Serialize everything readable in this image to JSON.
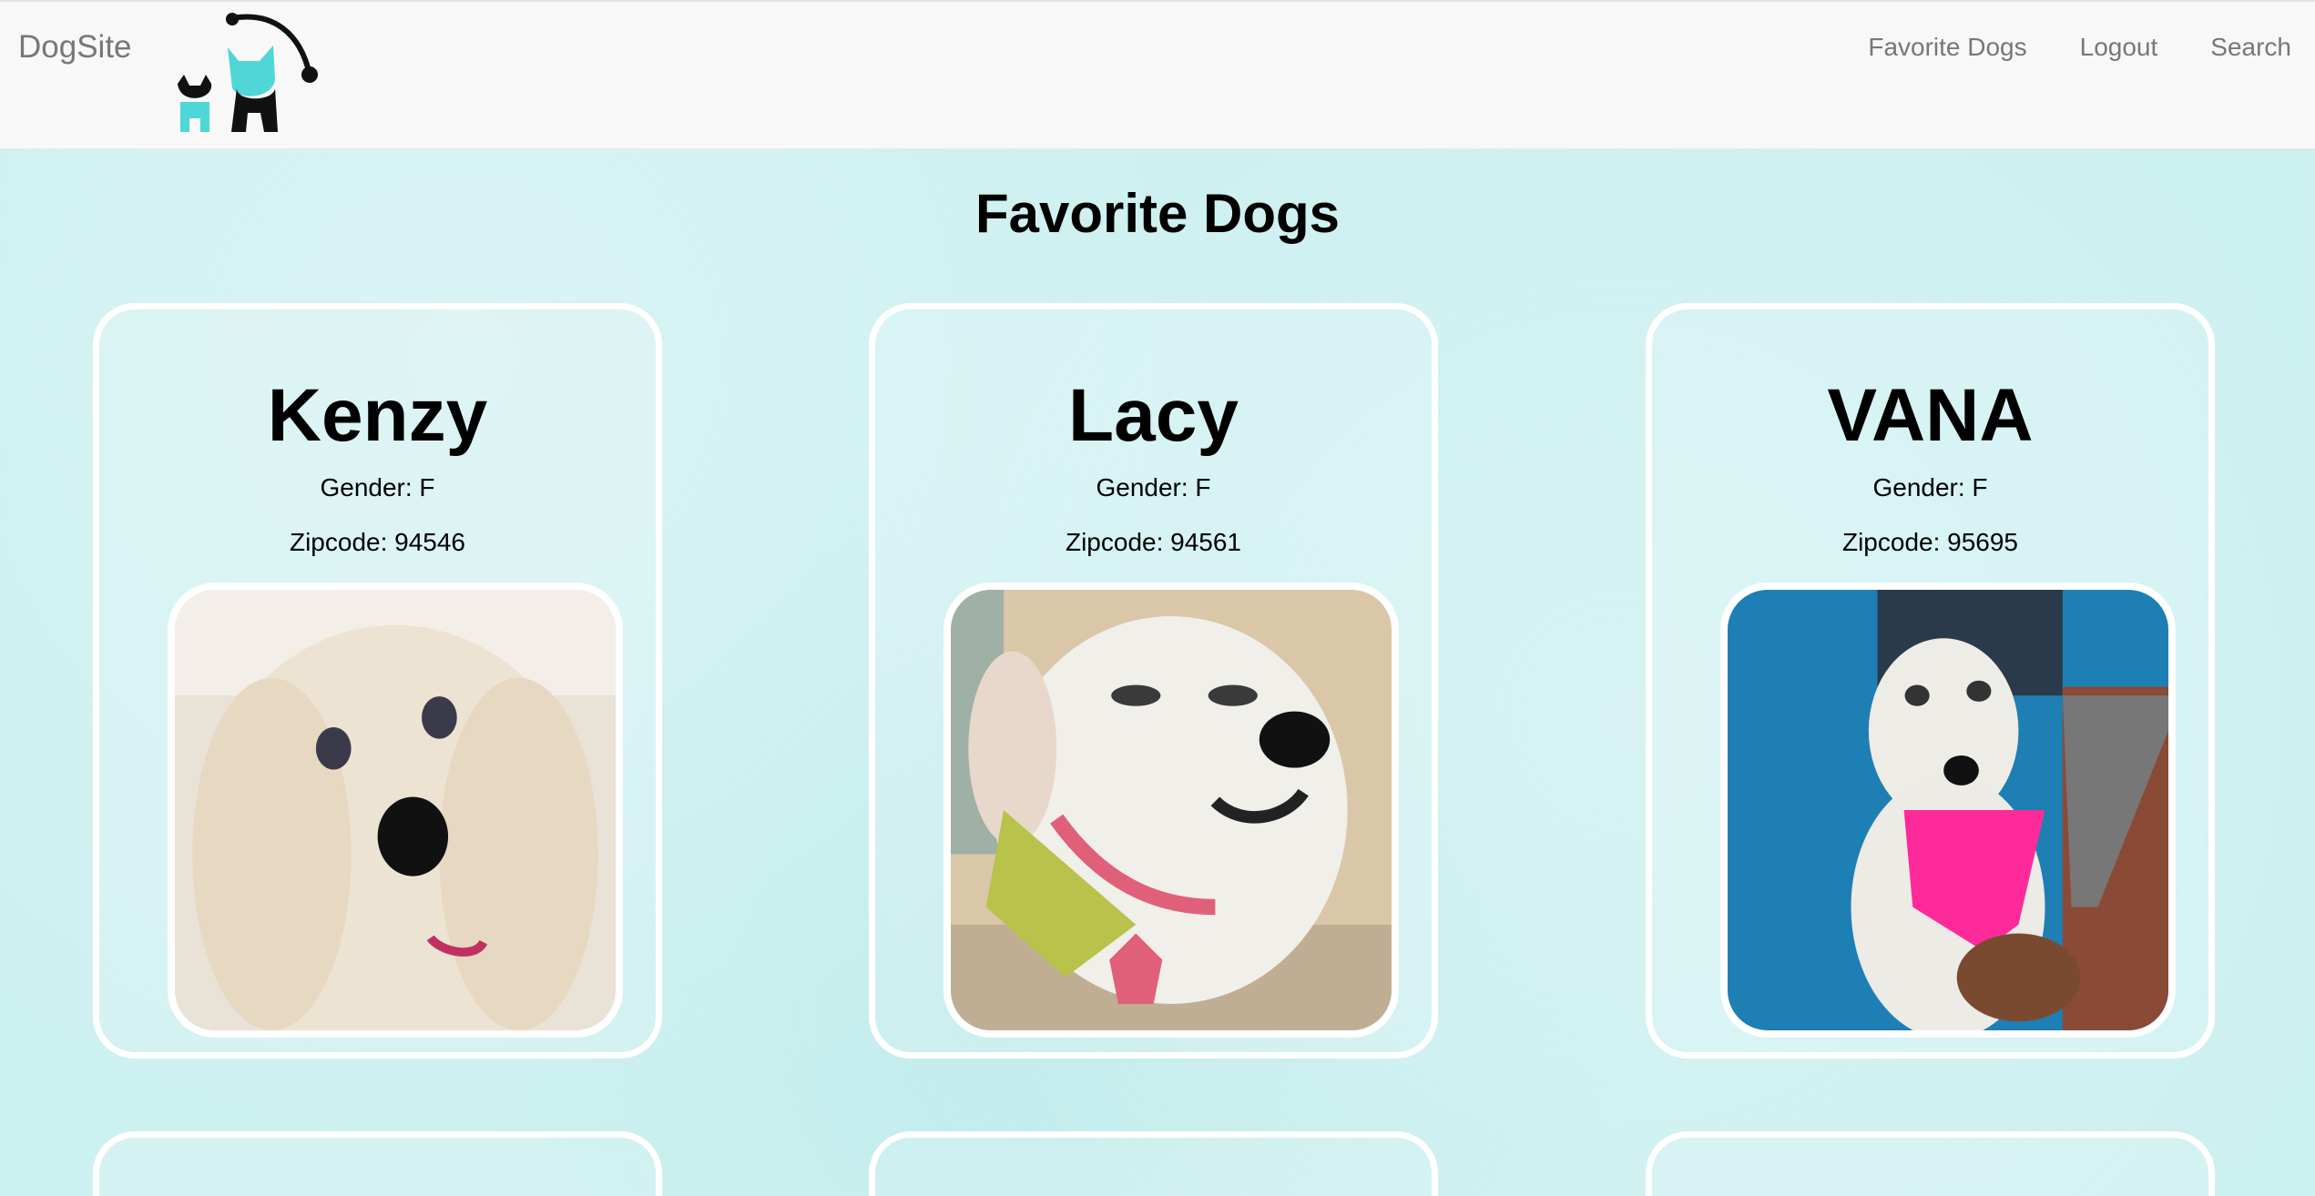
{
  "navbar": {
    "brand": "DogSite",
    "logo_icon": "dog-cat-logo-icon",
    "links": [
      {
        "label": "Favorite Dogs"
      },
      {
        "label": "Logout"
      },
      {
        "label": "Search"
      }
    ]
  },
  "page": {
    "title": "Favorite Dogs"
  },
  "dogs": [
    {
      "name": "Kenzy",
      "gender": "Gender: F",
      "zipcode": "Zipcode: 94546",
      "photo_icon": "white-fluffy-dog-photo"
    },
    {
      "name": "Lacy",
      "gender": "Gender: F",
      "zipcode": "Zipcode: 94561",
      "photo_icon": "white-dog-bandana-photo"
    },
    {
      "name": "VANA",
      "gender": "Gender: F",
      "zipcode": "Zipcode: 95695",
      "photo_icon": "white-dog-pink-bandana-photo"
    }
  ],
  "colors": {
    "background": "#cdf0f0",
    "navbar": "#f8f8f8",
    "nav_text": "#777777",
    "card_border": "#ffffff",
    "logo_teal": "#4fd6d6"
  }
}
